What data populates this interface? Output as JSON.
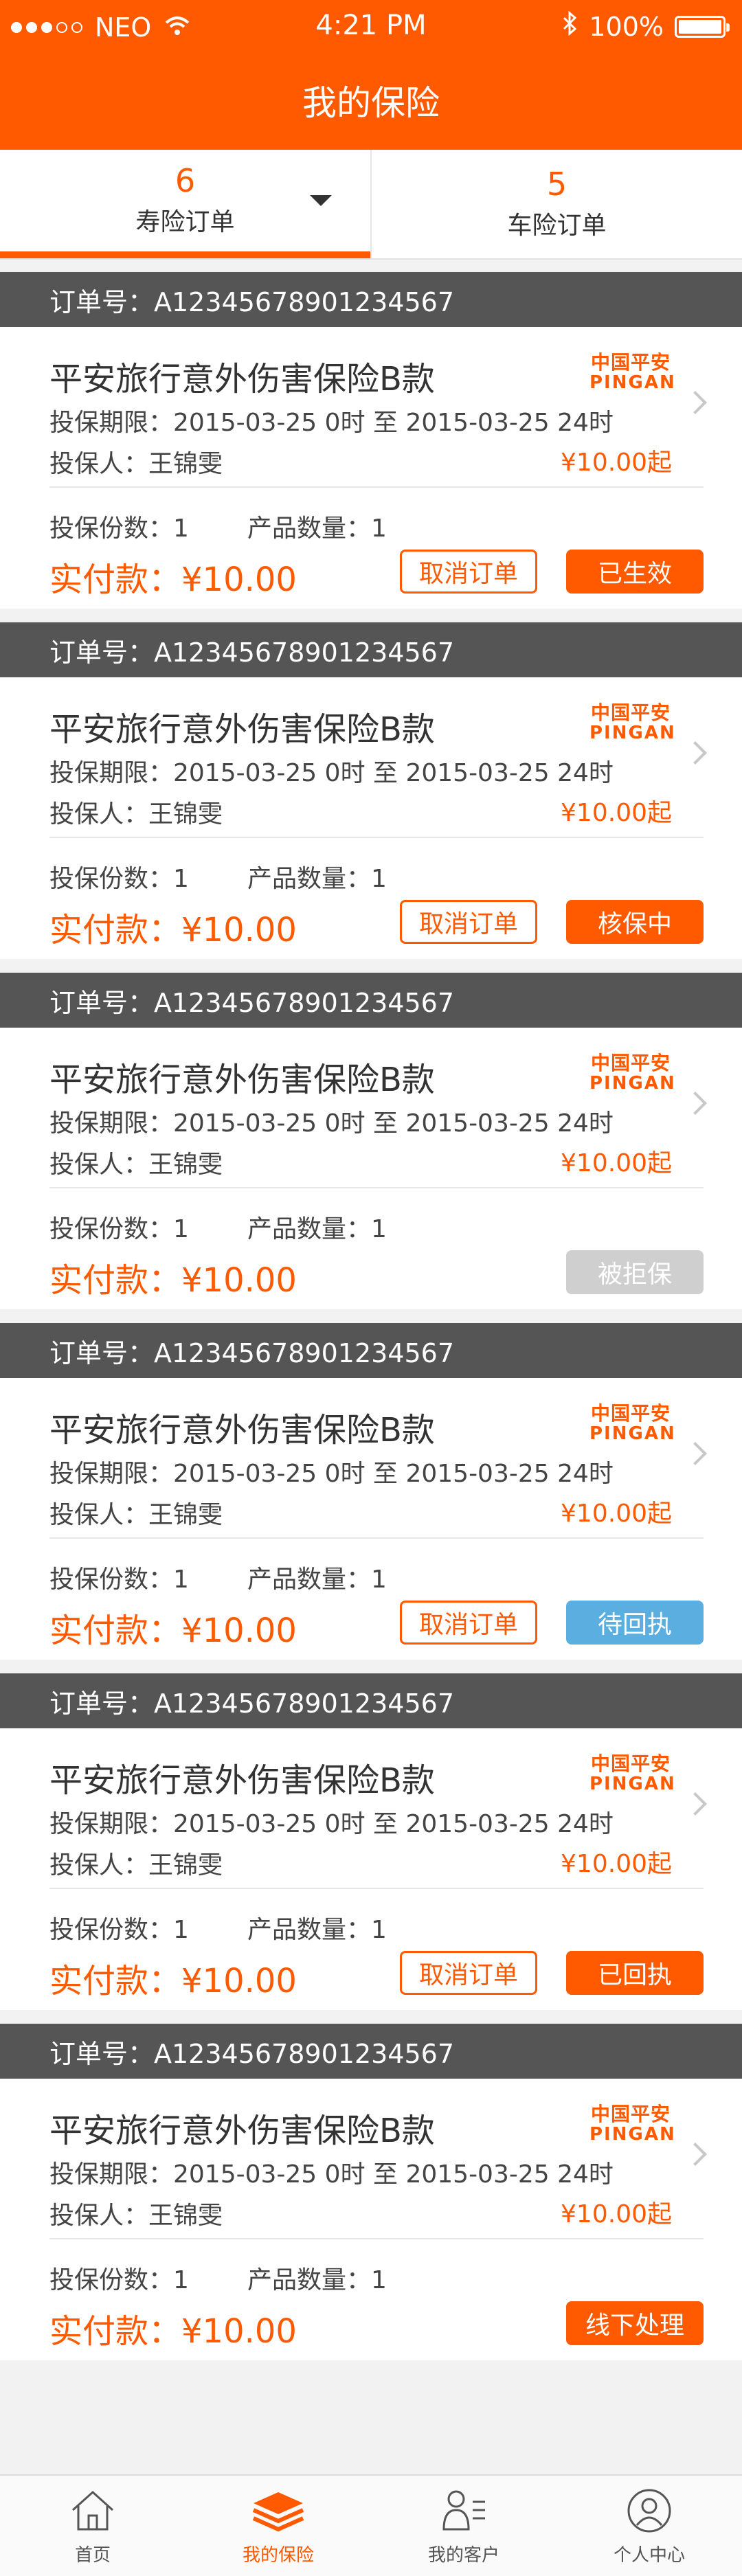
{
  "status_bar": {
    "carrier": "NEO",
    "time": "4:21 PM",
    "battery": "100%",
    "signal_bars_filled": 3,
    "signal_bars_total": 5
  },
  "header": {
    "title": "我的保险"
  },
  "tabs": [
    {
      "count": "6",
      "label": "寿险订单",
      "active": true
    },
    {
      "count": "5",
      "label": "车险订单",
      "active": false
    }
  ],
  "orders": [
    {
      "order_no": "订单号：A12345678901234567",
      "product": "平安旅行意外伤害保险B款",
      "period": "投保期限：2015-03-25  0时 至 2015-03-25  24时",
      "holder": "投保人：王锦雯",
      "price_from": "¥10.00起",
      "logo_cn": "中国平安",
      "logo_en": "PINGAN",
      "qty": "投保份数：1",
      "count": "产品数量：1",
      "paid": "实付款：¥10.00",
      "cancel_label": "取消订单",
      "status": "已生效",
      "status_color": "#ff5a00"
    },
    {
      "order_no": "订单号：A12345678901234567",
      "product": "平安旅行意外伤害保险B款",
      "period": "投保期限：2015-03-25  0时 至 2015-03-25  24时",
      "holder": "投保人：王锦雯",
      "price_from": "¥10.00起",
      "logo_cn": "中国平安",
      "logo_en": "PINGAN",
      "qty": "投保份数：1",
      "count": "产品数量：1",
      "paid": "实付款：¥10.00",
      "cancel_label": "取消订单",
      "status": "核保中",
      "status_color": "#ff5a00"
    },
    {
      "order_no": "订单号：A12345678901234567",
      "product": "平安旅行意外伤害保险B款",
      "period": "投保期限：2015-03-25  0时 至 2015-03-25  24时",
      "holder": "投保人：王锦雯",
      "price_from": "¥10.00起",
      "logo_cn": "中国平安",
      "logo_en": "PINGAN",
      "qty": "投保份数：1",
      "count": "产品数量：1",
      "paid": "实付款：¥10.00",
      "cancel_label": null,
      "status": "被拒保",
      "status_color": "#cfcfcf"
    },
    {
      "order_no": "订单号：A12345678901234567",
      "product": "平安旅行意外伤害保险B款",
      "period": "投保期限：2015-03-25  0时 至 2015-03-25  24时",
      "holder": "投保人：王锦雯",
      "price_from": "¥10.00起",
      "logo_cn": "中国平安",
      "logo_en": "PINGAN",
      "qty": "投保份数：1",
      "count": "产品数量：1",
      "paid": "实付款：¥10.00",
      "cancel_label": "取消订单",
      "status": "待回执",
      "status_color": "#5aaee0"
    },
    {
      "order_no": "订单号：A12345678901234567",
      "product": "平安旅行意外伤害保险B款",
      "period": "投保期限：2015-03-25  0时 至 2015-03-25  24时",
      "holder": "投保人：王锦雯",
      "price_from": "¥10.00起",
      "logo_cn": "中国平安",
      "logo_en": "PINGAN",
      "qty": "投保份数：1",
      "count": "产品数量：1",
      "paid": "实付款：¥10.00",
      "cancel_label": "取消订单",
      "status": "已回执",
      "status_color": "#ff5a00"
    },
    {
      "order_no": "订单号：A12345678901234567",
      "product": "平安旅行意外伤害保险B款",
      "period": "投保期限：2015-03-25  0时 至 2015-03-25  24时",
      "holder": "投保人：王锦雯",
      "price_from": "¥10.00起",
      "logo_cn": "中国平安",
      "logo_en": "PINGAN",
      "qty": "投保份数：1",
      "count": "产品数量：1",
      "paid": "实付款：¥10.00",
      "cancel_label": null,
      "status": "线下处理",
      "status_color": "#ff5a00"
    }
  ],
  "bottom_nav": [
    {
      "label": "首页",
      "icon": "home-icon",
      "active": false
    },
    {
      "label": "我的保险",
      "icon": "layers-icon",
      "active": true
    },
    {
      "label": "我的客户",
      "icon": "contacts-icon",
      "active": false
    },
    {
      "label": "个人中心",
      "icon": "profile-icon",
      "active": false
    }
  ],
  "colors": {
    "brand": "#ff5a00",
    "header_bar": "#555555",
    "rejected": "#cfcfcf",
    "pending_receipt": "#5aaee0"
  }
}
